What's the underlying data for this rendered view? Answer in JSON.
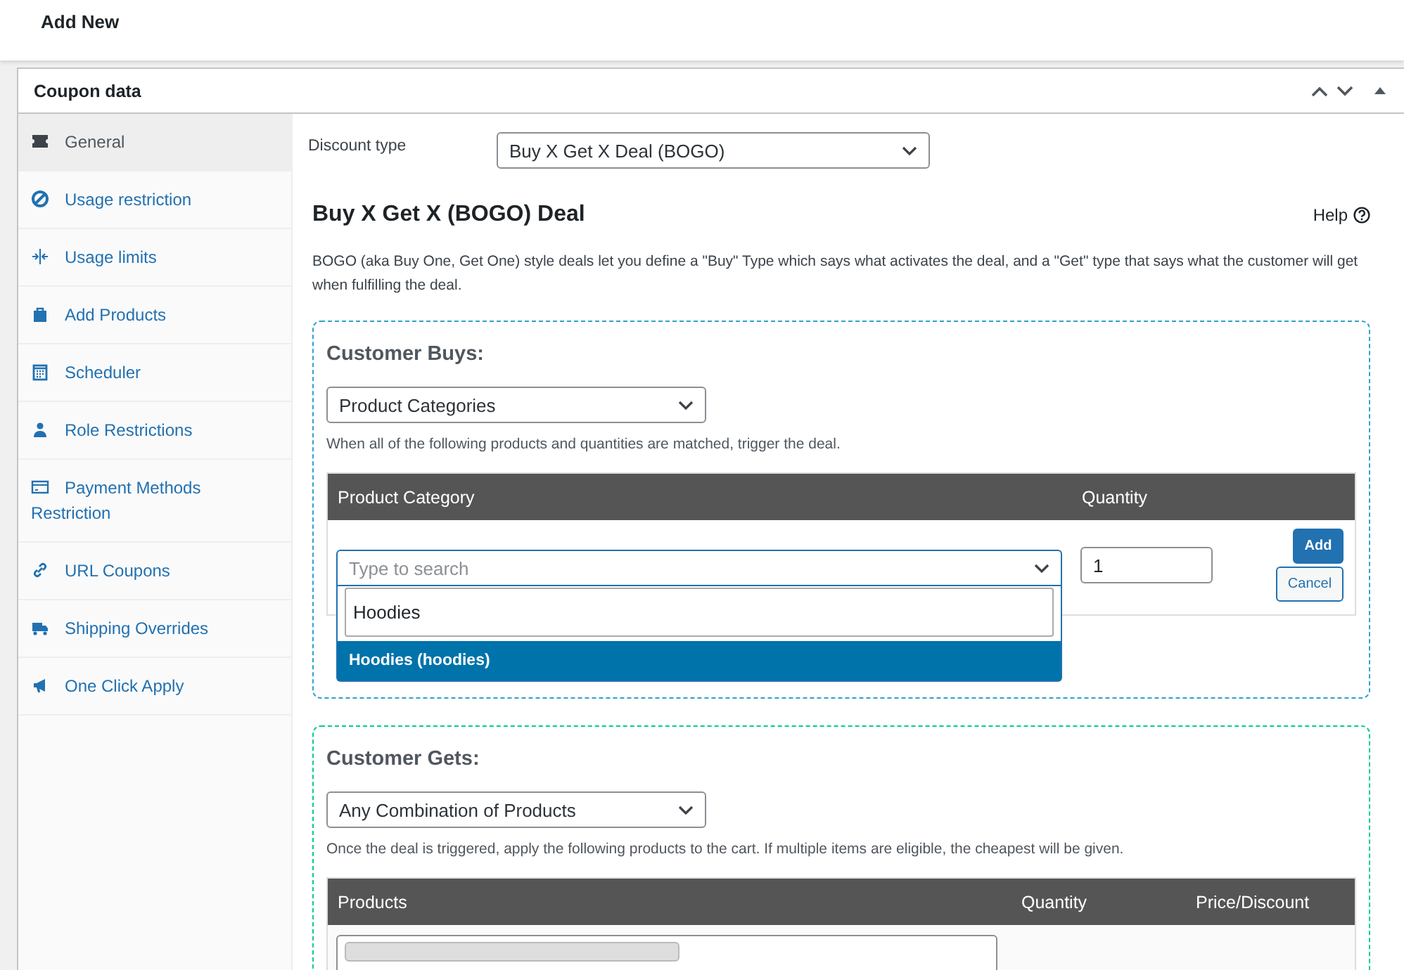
{
  "page_title": "Add New",
  "panel": {
    "title": "Coupon data"
  },
  "sidebar": {
    "items": [
      {
        "label": "General",
        "selected": true
      },
      {
        "label": "Usage restriction",
        "selected": false
      },
      {
        "label": "Usage limits",
        "selected": false
      },
      {
        "label": "Add Products",
        "selected": false
      },
      {
        "label": "Scheduler",
        "selected": false
      },
      {
        "label": "Role Restrictions",
        "selected": false
      },
      {
        "label": "Payment Methods Restriction",
        "selected": false
      },
      {
        "label": "URL Coupons",
        "selected": false
      },
      {
        "label": "Shipping Overrides",
        "selected": false
      },
      {
        "label": "One Click Apply",
        "selected": false
      }
    ]
  },
  "discount_type": {
    "label": "Discount type",
    "value": "Buy X Get X Deal (BOGO)"
  },
  "deal": {
    "title": "Buy X Get X (BOGO) Deal",
    "help": "Help",
    "description": "BOGO (aka Buy One, Get One) style deals let you define a \"Buy\" Type which says what activates the deal, and a \"Get\" type that says what the customer will get when fulfilling the deal."
  },
  "customer_buys": {
    "title": "Customer Buys:",
    "type_value": "Product Categories",
    "note": "When all of the following products and quantities are matched, trigger the deal.",
    "columns": [
      "Product Category",
      "Quantity"
    ],
    "row": {
      "category_placeholder": "Type to search",
      "search_value": "Hoodies",
      "options": [
        {
          "label": "Hoodies (hoodies)",
          "selected": true
        }
      ],
      "quantity": "1"
    },
    "buttons": [
      "Add",
      "Cancel"
    ]
  },
  "customer_gets": {
    "title": "Customer Gets:",
    "type_value": "Any Combination of Products",
    "note": "Once the deal is triggered, apply the following products to the cart. If multiple items are eligible, the cheapest will be given.",
    "columns": [
      "Products",
      "Quantity",
      "Price/Discount"
    ]
  }
}
